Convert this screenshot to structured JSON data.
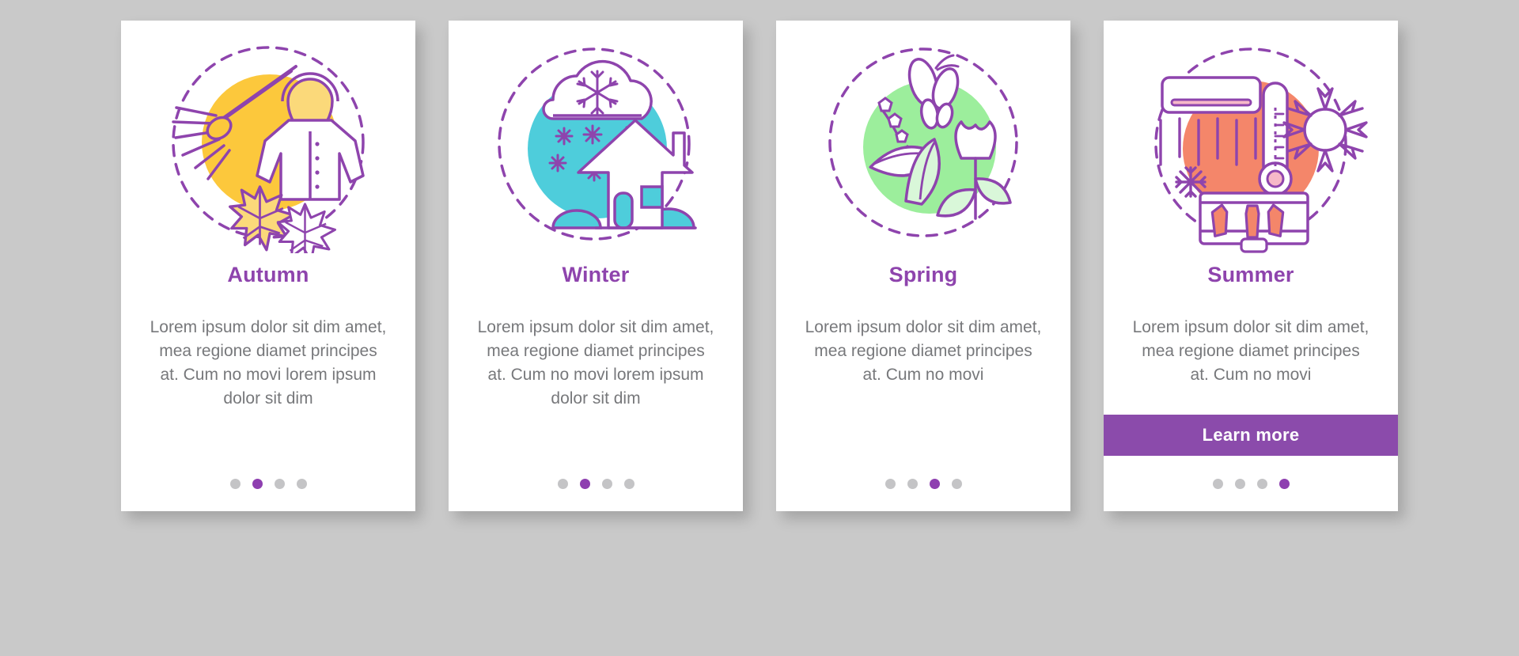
{
  "page": {
    "background_color": "#c9c9c9",
    "accent_color": "#8e44ad",
    "body_text_color": "#77787b",
    "dot_inactive_color": "#c4c4c6",
    "dot_active_color": "#8e3fb0"
  },
  "cards": [
    {
      "id": "autumn",
      "title": "Autumn",
      "body": "Lorem ipsum dolor sit dim amet, mea regione diamet principes at. Cum no movi lorem ipsum dolor sit dim",
      "illustration": "autumn-rake-coat-leaves-icon",
      "blob_color": "#fcc83c",
      "dots_total": 4,
      "dots_active_index": 1,
      "has_button": false,
      "button_label": ""
    },
    {
      "id": "winter",
      "title": "Winter",
      "body": "Lorem ipsum dolor sit dim amet, mea regione diamet principes at. Cum no movi lorem ipsum dolor sit dim",
      "illustration": "winter-snow-cloud-house-icon",
      "blob_color": "#4ecddb",
      "dots_total": 4,
      "dots_active_index": 1,
      "has_button": false,
      "button_label": ""
    },
    {
      "id": "spring",
      "title": "Spring",
      "body": "Lorem ipsum dolor sit dim amet, mea regione diamet principes at. Cum no movi",
      "illustration": "spring-butterfly-tulip-leaves-icon",
      "blob_color": "#9cee9c",
      "dots_total": 4,
      "dots_active_index": 2,
      "has_button": false,
      "button_label": ""
    },
    {
      "id": "summer",
      "title": "Summer",
      "body": "Lorem ipsum dolor sit dim amet, mea regione diamet principes at. Cum no movi",
      "illustration": "summer-ac-thermometer-sun-cooler-icon",
      "blob_color": "#f4866a",
      "dots_total": 4,
      "dots_active_index": 3,
      "has_button": true,
      "button_label": "Learn more"
    }
  ]
}
